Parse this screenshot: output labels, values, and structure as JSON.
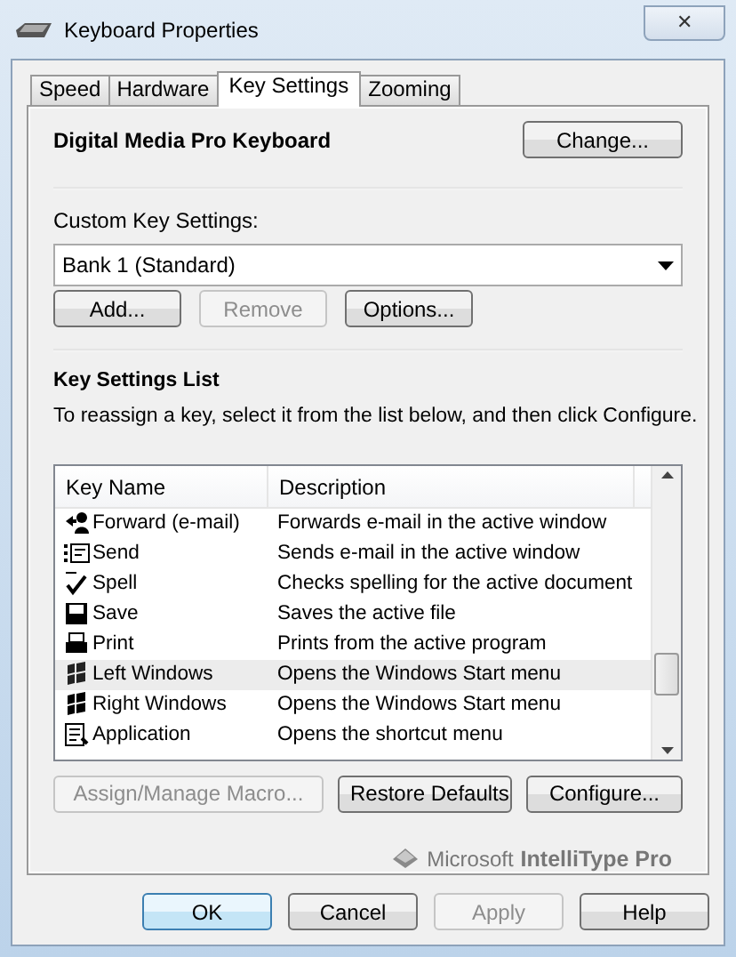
{
  "window": {
    "title": "Keyboard Properties",
    "close": "✕"
  },
  "tabs": [
    {
      "label": "Speed",
      "selected": false
    },
    {
      "label": "Hardware",
      "selected": false
    },
    {
      "label": "Key Settings",
      "selected": true
    },
    {
      "label": "Zooming",
      "selected": false
    }
  ],
  "device": {
    "name": "Digital Media Pro Keyboard",
    "button": "Change..."
  },
  "custom": {
    "label": "Custom Key Settings:",
    "value": "Bank 1 (Standard)",
    "buttons": [
      {
        "label": "Add...",
        "disabled": false
      },
      {
        "label": "Remove",
        "disabled": true
      },
      {
        "label": "Options...",
        "disabled": false
      }
    ]
  },
  "key_list": {
    "heading": "Key Settings List",
    "instruction": "To reassign a key, select it from the list below, and then click Configure.",
    "columns": [
      "Key Name",
      "Description"
    ],
    "rows": [
      {
        "key": "Forward (e-mail)",
        "description": "Forwards e-mail in the active window",
        "selected": false
      },
      {
        "key": "Send",
        "description": "Sends e-mail in the active window",
        "selected": false
      },
      {
        "key": "Spell",
        "description": "Checks spelling for the active document",
        "selected": false
      },
      {
        "key": "Save",
        "description": "Saves the active file",
        "selected": false
      },
      {
        "key": "Print",
        "description": "Prints from the active program",
        "selected": false
      },
      {
        "key": "Left Windows",
        "description": "Opens the Windows Start menu",
        "selected": true
      },
      {
        "key": "Right Windows",
        "description": "Opens the Windows Start menu",
        "selected": false
      },
      {
        "key": "Application",
        "description": "Opens the shortcut menu",
        "selected": false
      }
    ],
    "buttons": [
      {
        "label": "Assign/Manage Macro...",
        "disabled": true
      },
      {
        "label": "Restore Defaults",
        "disabled": false
      },
      {
        "label": "Configure...",
        "disabled": false
      }
    ]
  },
  "brand": {
    "company": "Microsoft",
    "product": "IntelliType Pro"
  },
  "dialog_buttons": [
    {
      "label": "OK",
      "disabled": false,
      "default": true
    },
    {
      "label": "Cancel",
      "disabled": false,
      "default": false
    },
    {
      "label": "Apply",
      "disabled": true,
      "default": false
    },
    {
      "label": "Help",
      "disabled": false,
      "default": false
    }
  ]
}
